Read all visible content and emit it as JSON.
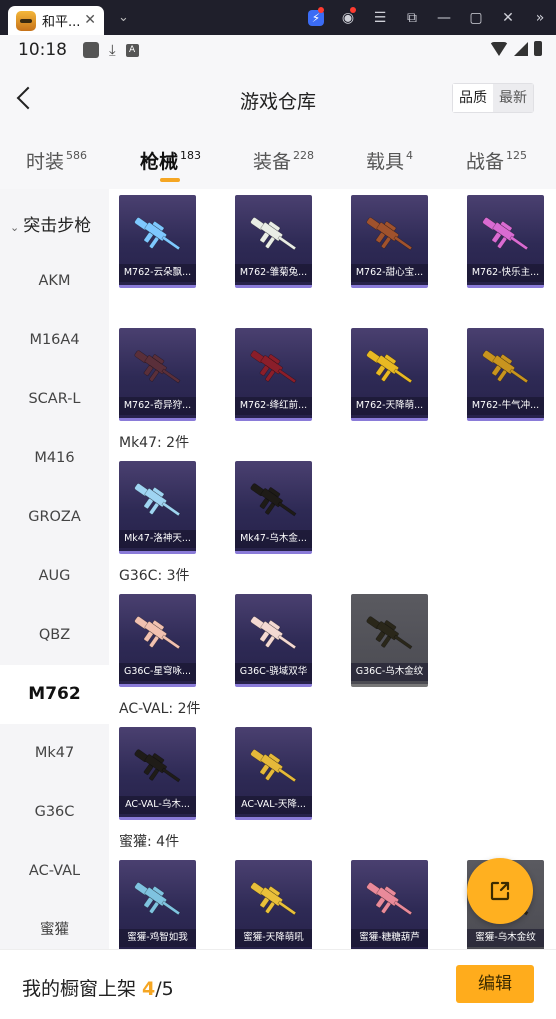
{
  "window": {
    "tab_title": "和平...",
    "close_glyph": "✕",
    "chevron_glyph": "⌄"
  },
  "status_bar": {
    "time": "10:18"
  },
  "header": {
    "title": "游戏仓库",
    "sort_options": [
      "品质",
      "最新"
    ],
    "sort_selected": "品质"
  },
  "categories": [
    {
      "label": "时装",
      "count": "586"
    },
    {
      "label": "枪械",
      "count": "183",
      "active": true
    },
    {
      "label": "装备",
      "count": "228"
    },
    {
      "label": "载具",
      "count": "4"
    },
    {
      "label": "战备",
      "count": "125"
    }
  ],
  "sidebar": {
    "group_title": "突击步枪",
    "items": [
      "AKM",
      "M16A4",
      "SCAR-L",
      "M416",
      "GROZA",
      "AUG",
      "QBZ",
      "M762",
      "Mk47",
      "G36C",
      "AC-VAL",
      "蜜獾"
    ],
    "active": "M762"
  },
  "sections": {
    "mk47": "Mk47: 2件",
    "g36c": "G36C: 3件",
    "acval": "AC-VAL: 2件",
    "honeybadger": "蜜獾: 4件"
  },
  "cards": [
    {
      "label": "M762-云朵飘...",
      "tint": "#7ec8ff"
    },
    {
      "label": "M762-雏菊兔...",
      "tint": "#e9ede6"
    },
    {
      "label": "M762-甜心宝...",
      "tint": "#a0522d"
    },
    {
      "label": "M762-快乐主...",
      "tint": "#d96bd2"
    },
    {
      "label": "M762-奇异狩...",
      "tint": "#5a2f3a"
    },
    {
      "label": "M762-绛红前...",
      "tint": "#8b1e2a"
    },
    {
      "label": "M762-天降萌...",
      "tint": "#e8b923"
    },
    {
      "label": "M762-牛气冲...",
      "tint": "#c8941f"
    },
    {
      "label": "Mk47-洛神天...",
      "tint": "#9fd4f2"
    },
    {
      "label": "Mk47-乌木金...",
      "tint": "#1e1b17"
    },
    {
      "label": "G36C-星穹咏...",
      "tint": "#f1c1b0"
    },
    {
      "label": "G36C-骁域双华",
      "tint": "#f4d9d2"
    },
    {
      "label": "G36C-乌木金纹",
      "tint": "#2a271a"
    },
    {
      "label": "AC-VAL-乌木...",
      "tint": "#1f1c18"
    },
    {
      "label": "AC-VAL-天降...",
      "tint": "#e5b93a"
    },
    {
      "label": "蜜獾-鸡智如我",
      "tint": "#7fc3e0"
    },
    {
      "label": "蜜獾-天降萌吼",
      "tint": "#e9c03a"
    },
    {
      "label": "蜜獾-糖糖葫芦",
      "tint": "#e98a9a"
    },
    {
      "label": "蜜獾-乌木金纹",
      "tint": "#2a261d"
    }
  ],
  "footer": {
    "label": "我的橱窗上架",
    "count": "4",
    "total": "/5",
    "edit_label": "编辑"
  },
  "colors": {
    "accent": "#f5a623",
    "button": "#ffac1c",
    "card_bg": "#2e2a55"
  }
}
